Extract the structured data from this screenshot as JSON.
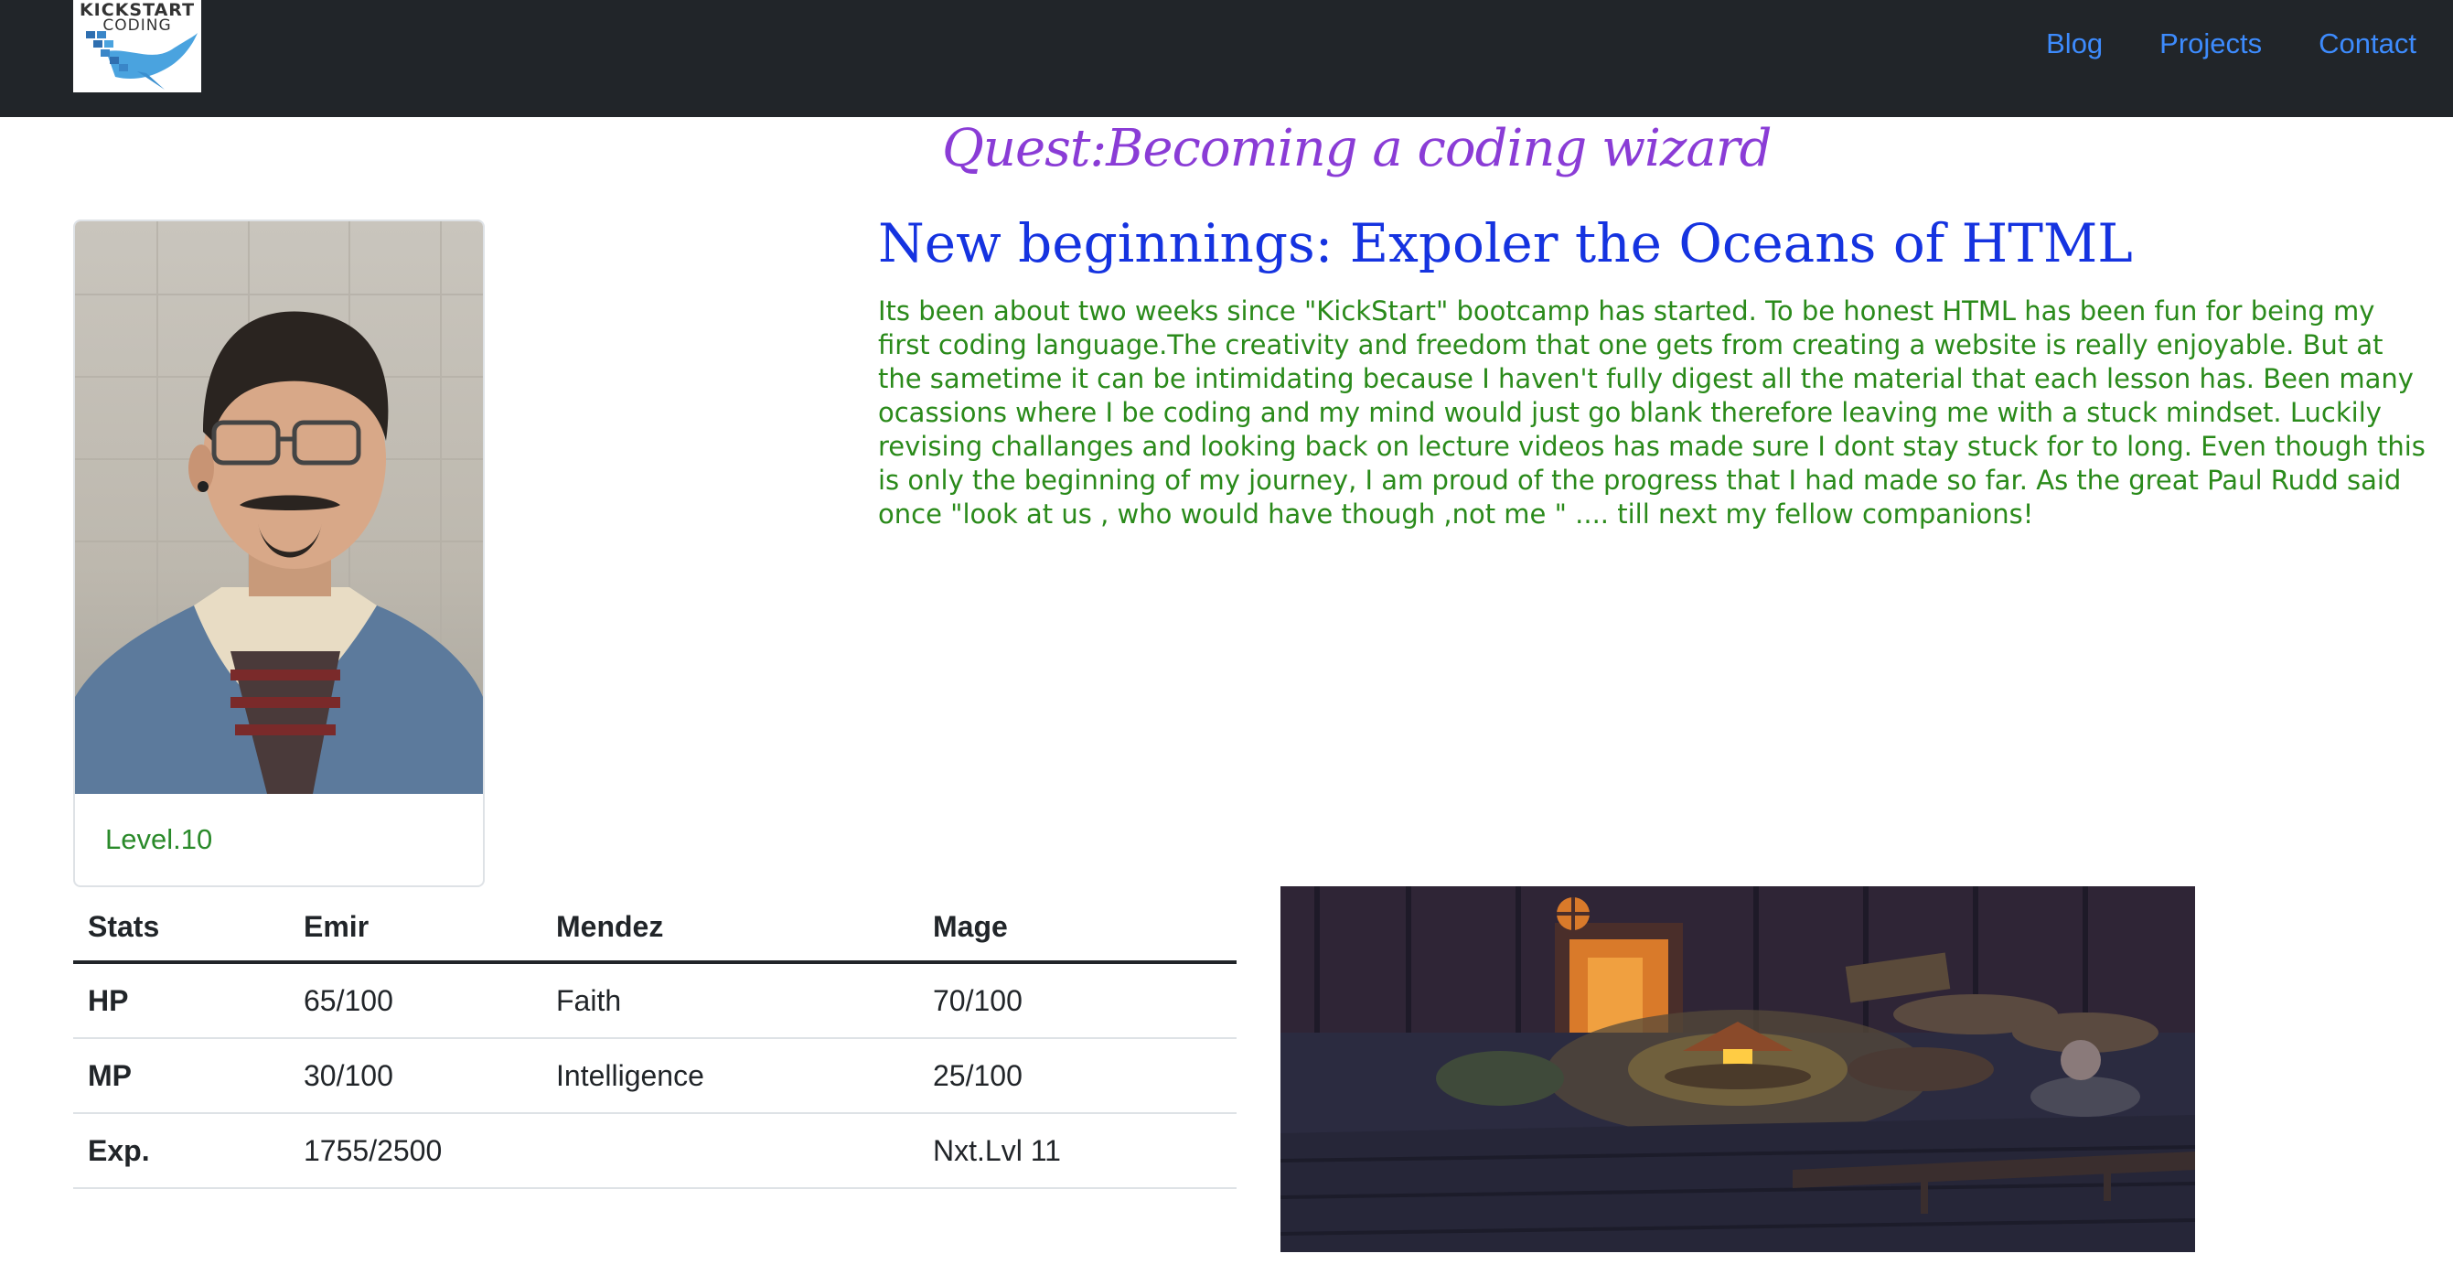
{
  "navbar": {
    "logo": {
      "line1": "KICKSTART",
      "line2": "CODING",
      "icon": "bird-logo"
    },
    "links": [
      "Blog",
      "Projects",
      "Contact"
    ]
  },
  "quest_title": "Quest:Becoming a coding wizard",
  "profile": {
    "level": "Level.10"
  },
  "post": {
    "title": "New beginnings: Expoler the Oceans of HTML",
    "body": "Its been about two weeks since \"KickStart\" bootcamp has started. To be honest HTML has been fun for being my first coding language.The creativity and freedom that one gets from creating a website is really enjoyable. But at the sametime it can be intimidating because I haven't fully digest all the material that each lesson has. Been many ocassions where I be coding and my mind would just go blank therefore leaving me with a stuck mindset. Luckily revising challanges and looking back on lecture videos has made sure I dont stay stuck for to long. Even though this is only the beginning of my journey, I am proud of the progress that I had made so far. As the great Paul Rudd said once \"look at us , who would have though ,not me \" .... till next my fellow companions!"
  },
  "stats": {
    "headers": [
      "Stats",
      "Emir",
      "Mendez",
      "Mage"
    ],
    "rows": [
      [
        "HP",
        "65/100",
        "Faith",
        "70/100"
      ],
      [
        "MP",
        "30/100",
        "Intelligence",
        "25/100"
      ],
      [
        "Exp.",
        "1755/2500",
        "",
        "Nxt.Lvl 11"
      ]
    ]
  },
  "colors": {
    "navbar_bg": "#212529",
    "nav_link": "#3d8bfd",
    "quest_title": "#8a3cd6",
    "post_title": "#1533e0",
    "post_body": "#2a8a1a",
    "level": "#2a8a2a"
  }
}
